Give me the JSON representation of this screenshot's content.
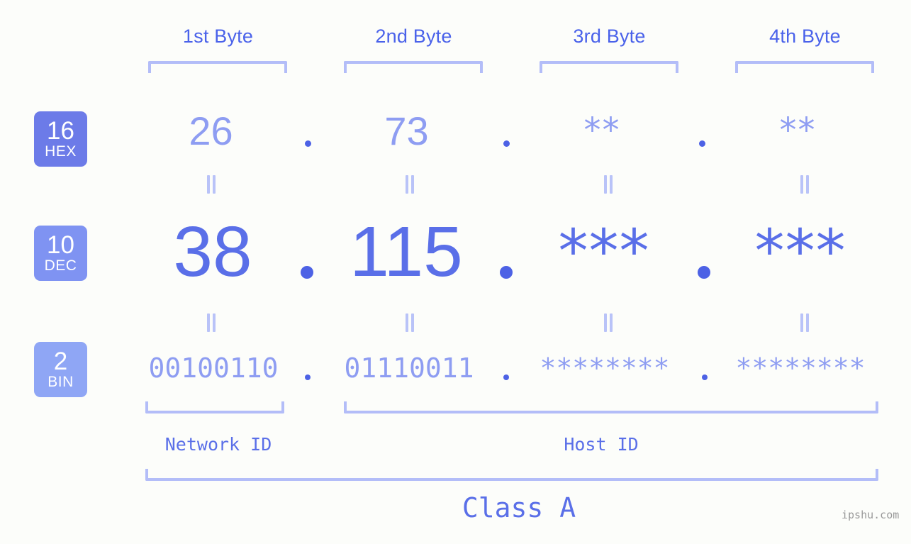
{
  "background_color": "#fcfdfa",
  "accent_color": "#5a6fe8",
  "accent_light_color": "#8e9df2",
  "bracket_color": "#b3bdf8",
  "columns": [
    {
      "label": "1st Byte"
    },
    {
      "label": "2nd Byte"
    },
    {
      "label": "3rd Byte"
    },
    {
      "label": "4th Byte"
    }
  ],
  "bases": [
    {
      "number": "16",
      "abbr": "HEX",
      "color": "#6c7be8"
    },
    {
      "number": "10",
      "abbr": "DEC",
      "color": "#7f93f2"
    },
    {
      "number": "2",
      "abbr": "BIN",
      "color": "#8fa6f5"
    }
  ],
  "rows": {
    "hex": {
      "values": [
        "26",
        "73",
        "**",
        "**"
      ]
    },
    "dec": {
      "values": [
        "38",
        "115",
        "***",
        "***"
      ]
    },
    "bin": {
      "values": [
        "00100110",
        "01110011",
        "********",
        "********"
      ]
    }
  },
  "separator": ".",
  "equals_symbol": "=",
  "segments": [
    {
      "label": "Network ID"
    },
    {
      "label": "Host ID"
    }
  ],
  "class": {
    "label": "Class A"
  },
  "watermark": {
    "text": "ipshu.com"
  }
}
